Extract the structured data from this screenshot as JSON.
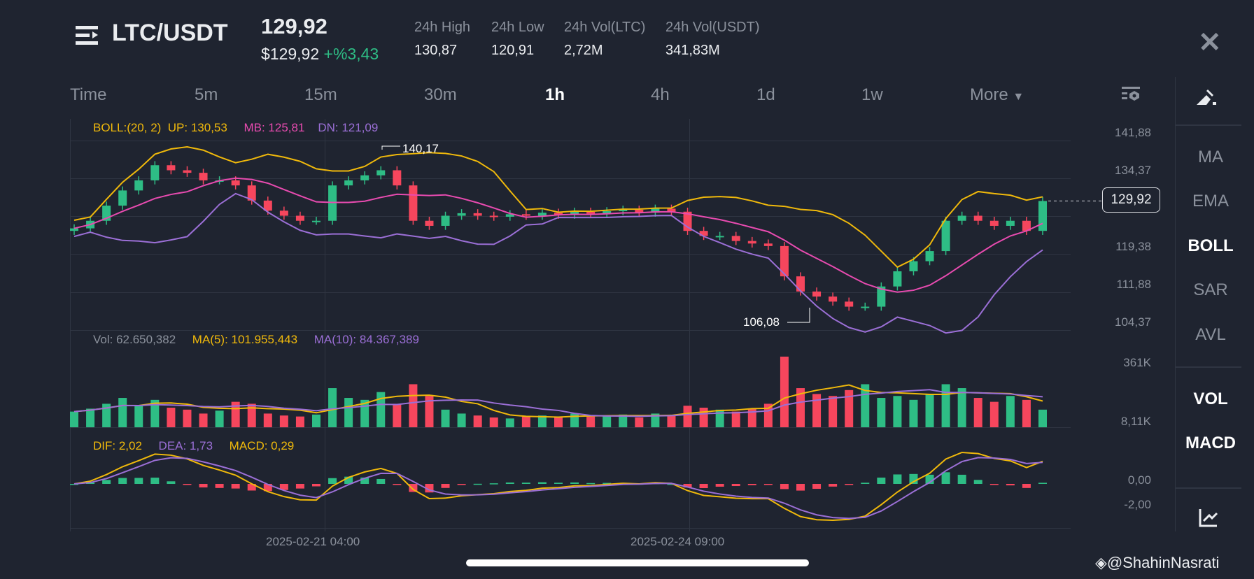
{
  "header": {
    "pair": "LTC/USDT",
    "price": "129,92",
    "price_usd": "$129,92",
    "change": "+%3,43",
    "stats": [
      {
        "label": "24h High",
        "value": "130,87"
      },
      {
        "label": "24h Low",
        "value": "120,91"
      },
      {
        "label": "24h Vol(LTC)",
        "value": "2,72M"
      },
      {
        "label": "24h Vol(USDT)",
        "value": "341,83M"
      }
    ]
  },
  "timeframes": [
    "Time",
    "5m",
    "15m",
    "30m",
    "1h",
    "4h",
    "1d",
    "1w",
    "More"
  ],
  "active_timeframe": "1h",
  "indicators": {
    "main": [
      "MA",
      "EMA",
      "BOLL",
      "SAR",
      "AVL"
    ],
    "sub": [
      "VOL",
      "MACD"
    ],
    "active_main": "BOLL"
  },
  "legends": {
    "boll": {
      "name": "BOLL:(20, 2)",
      "up": "UP: 130,53",
      "mb": "MB: 125,81",
      "dn": "DN: 121,09"
    },
    "vol": {
      "vol": "Vol: 62.650,382",
      "ma5": "MA(5): 101.955,443",
      "ma10": "MA(10): 84.367,389"
    },
    "macd": {
      "dif": "DIF: 2,02",
      "dea": "DEA: 1,73",
      "macd": "MACD: 0,29"
    }
  },
  "price_axis": [
    "141,88",
    "134,37",
    "119,38",
    "111,88",
    "104,37"
  ],
  "vol_axis": [
    "361K",
    "8,11K"
  ],
  "macd_axis": [
    "0,00",
    "-2,00"
  ],
  "time_axis": [
    "2025-02-21 04:00",
    "2025-02-24 09:00"
  ],
  "last_price": "129,92",
  "high_marker": "140,17",
  "low_marker": "106,08",
  "watermark": "@ShahinNasrati",
  "colors": {
    "up": "#2ebd85",
    "down": "#f6465d",
    "boll_up": "#f0b90b",
    "boll_mb": "#e84bb0",
    "boll_dn": "#9b6fd6",
    "bg": "#1f2430"
  },
  "chart_data": {
    "type": "candlestick",
    "price_range": [
      104.37,
      141.88
    ],
    "closes": [
      124.5,
      126,
      129,
      132,
      134,
      137,
      136,
      135.5,
      134,
      134,
      133,
      130,
      128,
      127,
      126,
      126,
      133,
      134,
      135,
      136,
      133,
      126,
      125,
      127,
      127.5,
      127,
      126.8,
      127.3,
      127,
      127.6,
      127.2,
      127.8,
      127.4,
      127.9,
      128.2,
      127.6,
      128.4,
      127.8,
      124,
      123,
      123,
      122,
      121.5,
      121,
      115,
      112,
      111,
      110,
      109,
      109,
      113,
      116,
      118,
      120,
      126,
      127,
      126,
      125,
      126,
      124,
      129.92
    ],
    "volumes_k": [
      80,
      95,
      120,
      150,
      110,
      140,
      100,
      90,
      70,
      85,
      130,
      120,
      70,
      60,
      55,
      65,
      200,
      150,
      140,
      180,
      120,
      220,
      160,
      90,
      70,
      60,
      50,
      45,
      55,
      60,
      50,
      70,
      55,
      60,
      65,
      50,
      70,
      60,
      110,
      100,
      90,
      80,
      95,
      120,
      361,
      200,
      170,
      160,
      190,
      220,
      150,
      160,
      140,
      170,
      220,
      200,
      150,
      130,
      160,
      140,
      90
    ]
  }
}
